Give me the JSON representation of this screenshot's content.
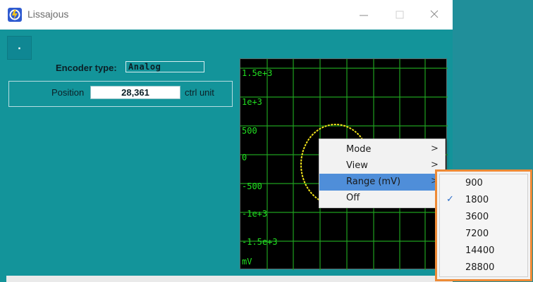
{
  "window": {
    "title": "Lissajous",
    "controls": {
      "minimize_icon": "minimize-icon",
      "maximize_icon": "maximize-icon",
      "close_icon": "close-icon"
    }
  },
  "toolbar": {
    "dot_button_label": "."
  },
  "encoder": {
    "label": "Encoder type:",
    "value": "Analog"
  },
  "position": {
    "label": "Position",
    "value": "28,361",
    "unit": "ctrl unit"
  },
  "scope": {
    "y_labels": [
      "1.5e+3",
      "1e+3",
      "500",
      "0",
      "-500",
      "-1e+3",
      "-1.5e+3",
      "mV"
    ],
    "trace_color": "#f0e21a",
    "grid_color": "#1fa01f",
    "label_color": "#22e021"
  },
  "context_menu": {
    "items": [
      {
        "label": "Mode",
        "has_submenu": true,
        "highlighted": false
      },
      {
        "label": "View",
        "has_submenu": true,
        "highlighted": false
      },
      {
        "label": "Range (mV)",
        "has_submenu": true,
        "highlighted": true
      },
      {
        "label": "Off",
        "has_submenu": false,
        "highlighted": false
      }
    ],
    "arrow_glyph": ">",
    "highlight_color": "#4f8ed9"
  },
  "range_submenu": {
    "items": [
      {
        "label": "900",
        "checked": false
      },
      {
        "label": "1800",
        "checked": true
      },
      {
        "label": "3600",
        "checked": false
      },
      {
        "label": "7200",
        "checked": false
      },
      {
        "label": "14400",
        "checked": false
      },
      {
        "label": "28800",
        "checked": false
      }
    ],
    "check_glyph": "✓",
    "callout_border_color": "#ee8a35"
  }
}
